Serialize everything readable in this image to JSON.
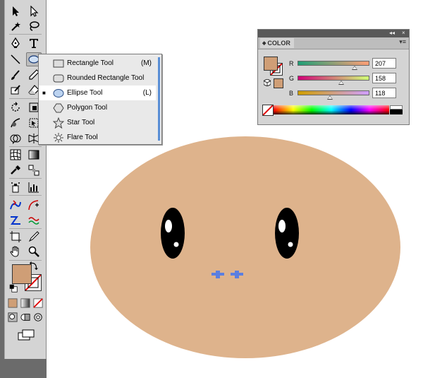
{
  "tool_flyout": {
    "items": [
      {
        "label": "Rectangle Tool",
        "shortcut": "(M)",
        "icon": "rectangle-icon",
        "selected": false
      },
      {
        "label": "Rounded Rectangle Tool",
        "shortcut": "",
        "icon": "rounded-rectangle-icon",
        "selected": false
      },
      {
        "label": "Ellipse Tool",
        "shortcut": "(L)",
        "icon": "ellipse-icon",
        "selected": true
      },
      {
        "label": "Polygon Tool",
        "shortcut": "",
        "icon": "polygon-icon",
        "selected": false
      },
      {
        "label": "Star Tool",
        "shortcut": "",
        "icon": "star-icon",
        "selected": false
      },
      {
        "label": "Flare Tool",
        "shortcut": "",
        "icon": "flare-icon",
        "selected": false
      }
    ],
    "selected_marker": "■"
  },
  "color_panel": {
    "title": "COLOR",
    "collapse_glyph": "◂◂",
    "close_glyph": "×",
    "menu_glyph": "▾≡",
    "fill_color": "#cf9e76",
    "channels": [
      {
        "label": "R",
        "value": "207",
        "fraction": 0.81,
        "gradient": [
          "#1f9e76",
          "#ff9e76"
        ]
      },
      {
        "label": "G",
        "value": "158",
        "fraction": 0.62,
        "gradient": [
          "#cf0076",
          "#cfff76"
        ]
      },
      {
        "label": "B",
        "value": "118",
        "fraction": 0.46,
        "gradient": [
          "#cf9e00",
          "#cf9eff"
        ]
      }
    ]
  },
  "toolbox": {
    "fill_color": "#cf9e76",
    "stroke": "none"
  },
  "artwork": {
    "face_color": "#deb38c",
    "eye_color": "#000000",
    "highlight_color": "#ffffff",
    "anchor_color": "#5b7fe0"
  }
}
